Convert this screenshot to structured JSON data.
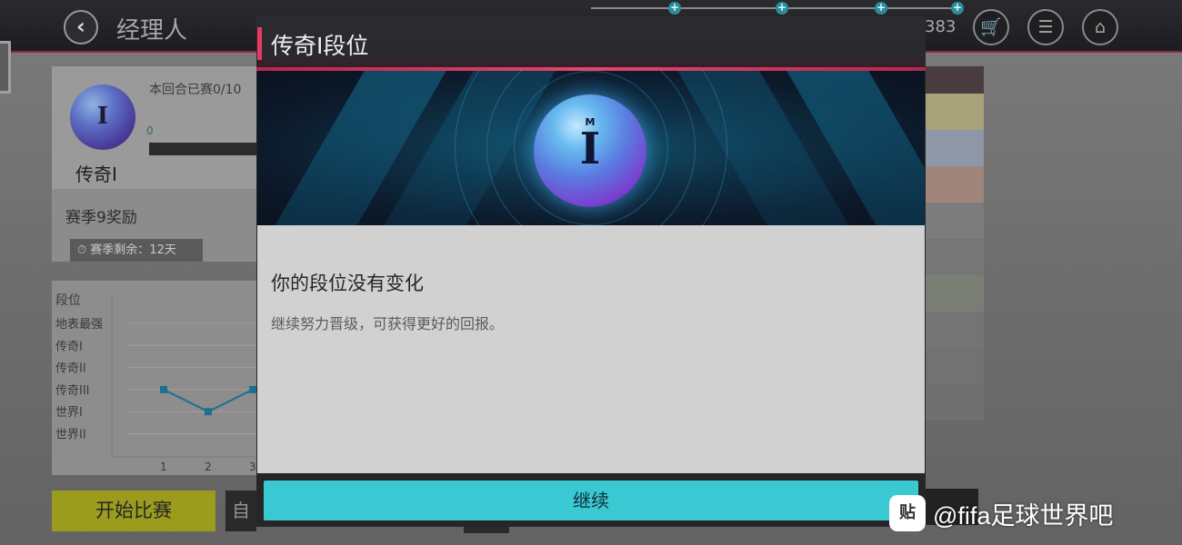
{
  "background": {
    "header": {
      "title": "经理人",
      "currency_value": "383",
      "back_icon": "chevron-left-icon",
      "cart_icon": "cart-icon",
      "tasks_icon": "checklist-icon",
      "home_icon": "home-icon"
    },
    "rank_panel": {
      "played_label": "本回合已赛0/10",
      "progress_zero": "0",
      "rank_name": "传奇I",
      "rank_glyph": "I",
      "season_reward": "赛季9奖励",
      "remaining_label": "赛季剩余：",
      "remaining_value": "12天"
    },
    "rank_chart": {
      "y_title": "段位",
      "y_labels": [
        "地表最强",
        "传奇I",
        "传奇II",
        "传奇III",
        "世界I",
        "世界II"
      ],
      "x_labels": [
        "1",
        "2",
        "3"
      ]
    },
    "buttons": {
      "start": "开始比赛",
      "auto": "自"
    },
    "accent_colors": {
      "stripe": "#e63a63",
      "continue": "#3ac8d3",
      "start": "#9b9b1d"
    }
  },
  "chart_data": {
    "type": "line",
    "title": "",
    "ylabel": "段位",
    "xlabel": "",
    "categories": [
      "1",
      "2",
      "3"
    ],
    "y_categories": [
      "世界II",
      "世界I",
      "传奇III",
      "传奇II",
      "传奇I",
      "地表最强"
    ],
    "series": [
      {
        "values": [
          "传奇III",
          "世界I",
          "传奇III"
        ]
      }
    ]
  },
  "modal": {
    "title": "传奇I段位",
    "rank_glyph": "I",
    "rank_glyph_top": "M",
    "message_title": "你的段位没有变化",
    "message_sub": "继续努力晋级，可获得更好的回报。",
    "continue_label": "继续"
  },
  "watermark": {
    "logo": "贴",
    "text": "@fifa足球世界吧"
  }
}
